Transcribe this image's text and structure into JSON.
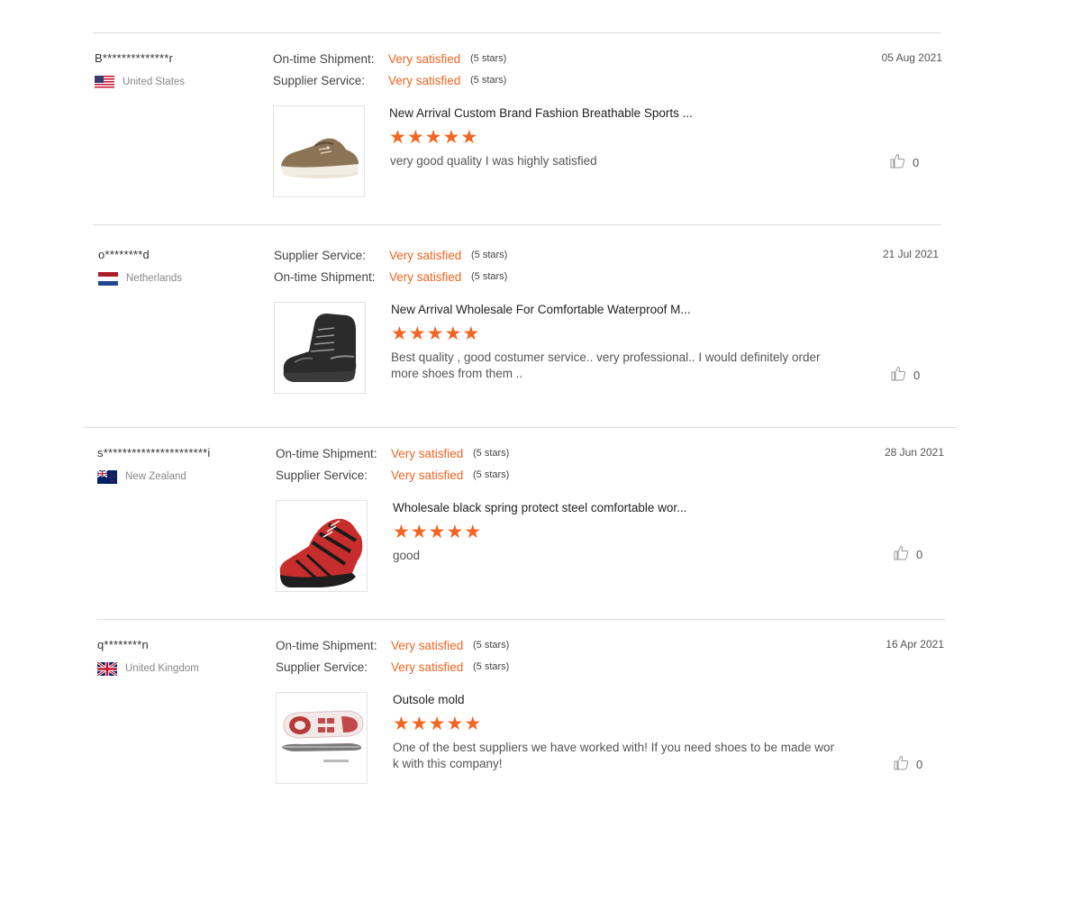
{
  "reviews": [
    {
      "buyer": "B**************r",
      "country": "United States",
      "flag": "us-flag",
      "ratings": [
        {
          "label": "On-time Shipment:",
          "value": "Very satisfied",
          "stars_text": "(5 stars)"
        },
        {
          "label": "Supplier Service:",
          "value": "Very satisfied",
          "stars_text": "(5 stars)"
        }
      ],
      "date": "05 Aug 2021",
      "product_title": "New Arrival Custom Brand Fashion Breathable Sports ...",
      "product_image": "brown-canvas-shoe",
      "stars": 5,
      "comment": "very good quality I was highly satisfied",
      "likes": "0"
    },
    {
      "buyer": "o********d",
      "country": "Netherlands",
      "flag": "nl-flag",
      "ratings": [
        {
          "label": "Supplier Service:",
          "value": "Very satisfied",
          "stars_text": "(5 stars)"
        },
        {
          "label": "On-time Shipment:",
          "value": "Very satisfied",
          "stars_text": "(5 stars)"
        }
      ],
      "date": "21 Jul 2021",
      "product_title": "New Arrival Wholesale For Comfortable Waterproof M...",
      "product_image": "black-hiking-boot",
      "stars": 5,
      "comment": "Best quality  , good costumer service.. very professional.. I would definitely order\n more shoes from them ..",
      "likes": "0"
    },
    {
      "buyer": "s**********************i",
      "country": "New Zealand",
      "flag": "nz-flag",
      "ratings": [
        {
          "label": "On-time Shipment:",
          "value": "Very satisfied",
          "stars_text": "(5 stars)"
        },
        {
          "label": "Supplier Service:",
          "value": "Very satisfied",
          "stars_text": "(5 stars)"
        }
      ],
      "date": "28 Jun 2021",
      "product_title": "Wholesale black spring protect steel comfortable wor...",
      "product_image": "red-black-safety-shoe",
      "stars": 5,
      "comment": "good",
      "likes": "0"
    },
    {
      "buyer": "q********n",
      "country": "United Kingdom",
      "flag": "uk-flag",
      "ratings": [
        {
          "label": "On-time Shipment:",
          "value": "Very satisfied",
          "stars_text": "(5 stars)"
        },
        {
          "label": "Supplier Service:",
          "value": "Very satisfied",
          "stars_text": "(5 stars)"
        }
      ],
      "date": "16 Apr 2021",
      "product_title": "Outsole mold",
      "product_image": "outsole-mold",
      "stars": 5,
      "comment": "One of the best suppliers we have worked with! If you need shoes to be made wor\nk with this company!",
      "likes": "0"
    }
  ],
  "colors": {
    "accent": "#f26522",
    "divider": "#dddddd",
    "muted_text": "#888888"
  }
}
